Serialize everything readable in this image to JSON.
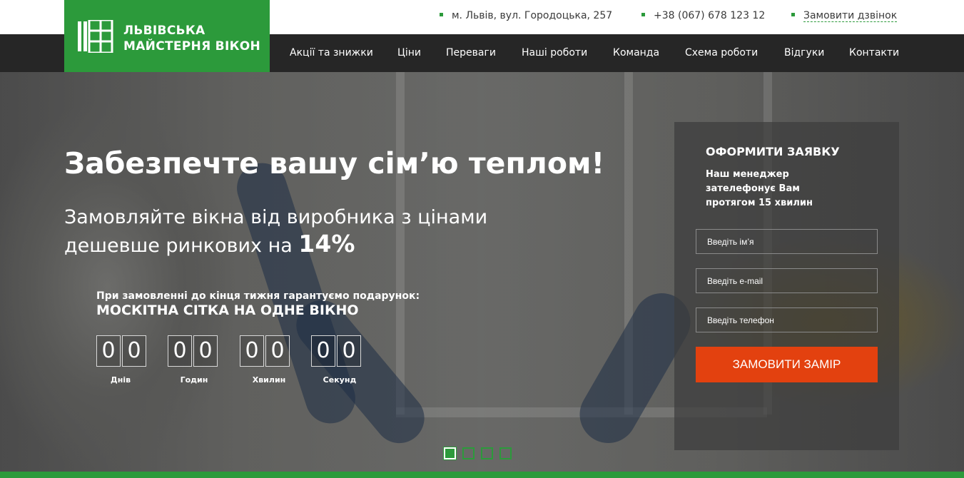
{
  "topbar": {
    "address": "м. Львів, вул. Городоцька, 257",
    "phone": "+38 (067) 678 123 12",
    "callback": "Замовити дзвінок"
  },
  "logo": {
    "line1": "ЛЬВІВСЬКА",
    "line2": "МАЙСТЕРНЯ ВІКОН",
    "icon": "window-building-icon"
  },
  "nav": {
    "items": [
      "Акції та знижки",
      "Ціни",
      "Переваги",
      "Наші роботи",
      "Команда",
      "Схема роботи",
      "Відгуки",
      "Контакти"
    ]
  },
  "hero": {
    "title": "Забезпечте вашу сім’ю теплом!",
    "subtitle_line1": "Замовляйте вікна від виробника з цінами",
    "subtitle_line2": "дешевше ринкових на",
    "subtitle_percent": "14%",
    "gift_line": "При замовленні до кінця тижня гарантуємо подарунок:",
    "gift_title": "МОСКІТНА СІТКА НА ОДНЕ ВІКНО"
  },
  "timer": {
    "days": [
      "0",
      "0"
    ],
    "hours": [
      "0",
      "0"
    ],
    "minutes": [
      "0",
      "0"
    ],
    "seconds": [
      "0",
      "0"
    ],
    "labels": [
      "Днів",
      "Годин",
      "Хвилин",
      "Секунд"
    ]
  },
  "form": {
    "title": "ОФОРМИТИ ЗАЯВКУ",
    "desc": "Наш менеджер зателефонує Вам протягом 15 хвилин",
    "name_placeholder": "Введіть ім’я",
    "email_placeholder": "Введіть e-mail",
    "phone_placeholder": "Введіть телефон",
    "submit": "ЗАМОВИТИ ЗАМІР"
  },
  "slider": {
    "count": 4,
    "active_index": 0
  },
  "colors": {
    "brand_green": "#2c9a3b",
    "nav_bg": "#262626",
    "cta_orange": "#e3410f"
  }
}
